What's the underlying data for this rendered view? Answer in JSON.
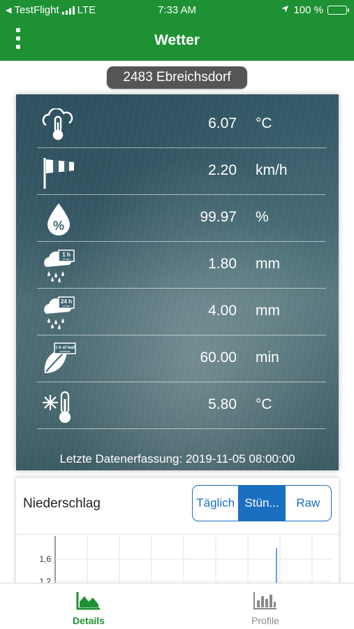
{
  "status": {
    "back_app": "TestFlight",
    "carrier": "LTE",
    "time": "7:33 AM",
    "battery": "100 %"
  },
  "app": {
    "title": "Wetter"
  },
  "location": "2483 Ebreichsdorf",
  "readings": [
    {
      "icon": "cloud-thermometer-icon",
      "value": "6.07",
      "unit": "°C"
    },
    {
      "icon": "windsock-icon",
      "value": "2.20",
      "unit": "km/h"
    },
    {
      "icon": "humidity-drop-icon",
      "value": "99.97",
      "unit": "%"
    },
    {
      "icon": "rain-1h-icon",
      "badge": "1 h of rain",
      "value": "1.80",
      "unit": "mm"
    },
    {
      "icon": "rain-24h-icon",
      "badge": "24 h of rain",
      "value": "4.00",
      "unit": "mm"
    },
    {
      "icon": "leaf-wetness-icon",
      "badge": "1 h of leaf wetness",
      "value": "60.00",
      "unit": "min"
    },
    {
      "icon": "frost-thermometer-icon",
      "value": "5.80",
      "unit": "°C"
    }
  ],
  "last_update": "Letzte Datenerfassung: 2019-11-05 08:00:00",
  "precip_card": {
    "title": "Niederschlag",
    "options": [
      "Täglich",
      "Stün...",
      "Raw"
    ],
    "selected": "Stün..."
  },
  "chart_data": {
    "type": "bar",
    "title": "",
    "y_ticks_visible": [
      "1,6",
      "1,2"
    ],
    "bars": [
      {
        "value": 1.8
      }
    ],
    "grid": true
  },
  "tabs": [
    {
      "label": "Details",
      "icon": "area-chart-icon",
      "active": true
    },
    {
      "label": "Profile",
      "icon": "bar-chart-icon",
      "active": false
    }
  ],
  "colors": {
    "brand": "#1e9134",
    "accent": "#1a6fc0",
    "pill": "#555555"
  }
}
